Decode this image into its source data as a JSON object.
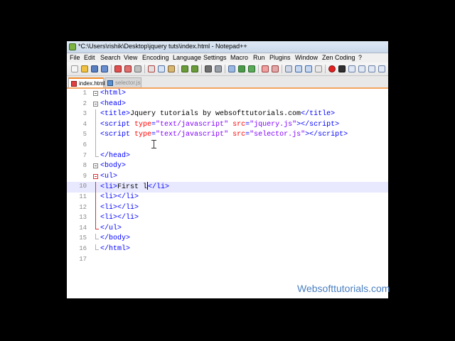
{
  "window": {
    "title": "*C:\\Users\\rishik\\Desktop\\jquery tuts\\index.html - Notepad++"
  },
  "menu": [
    "File",
    "Edit",
    "Search",
    "View",
    "Encoding",
    "Language",
    "Settings",
    "Macro",
    "Run",
    "Plugins",
    "Window",
    "Zen Coding",
    "?"
  ],
  "tabs": [
    {
      "label": "index.html",
      "active": true
    },
    {
      "label": "selector.js",
      "active": false
    }
  ],
  "editor": {
    "current_line": 10,
    "line_numbers": [
      "1",
      "2",
      "3",
      "4",
      "5",
      "6",
      "7",
      "8",
      "9",
      "10",
      "11",
      "12",
      "13",
      "14",
      "15",
      "16",
      "17"
    ]
  },
  "watermark": "Websofttutorials.com"
}
